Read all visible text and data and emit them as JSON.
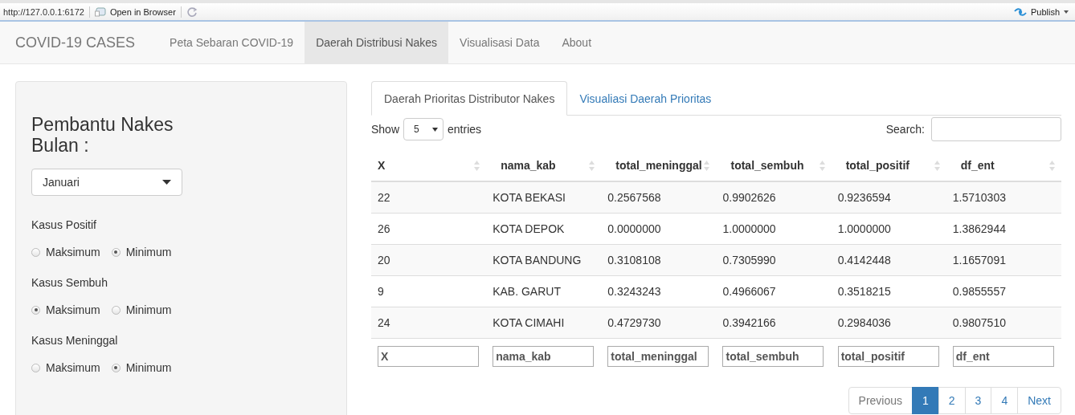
{
  "browser_bar": {
    "url": "http://127.0.0.1:6172",
    "open_in_browser": "Open in Browser",
    "publish": "Publish"
  },
  "navbar": {
    "brand": "COVID-19 CASES",
    "items": [
      {
        "label": "Peta Sebaran COVID-19",
        "selected": false
      },
      {
        "label": "Daerah Distribusi Nakes",
        "selected": true
      },
      {
        "label": "Visualisasi Data",
        "selected": false
      },
      {
        "label": "About",
        "selected": false
      }
    ]
  },
  "sidebar": {
    "title": "Pembantu Nakes Bulan :",
    "month_select": {
      "value": "Januari"
    },
    "groups": [
      {
        "label": "Kasus Positif",
        "options": [
          {
            "label": "Maksimum",
            "selected": false
          },
          {
            "label": "Minimum",
            "selected": true
          }
        ]
      },
      {
        "label": "Kasus Sembuh",
        "options": [
          {
            "label": "Maksimum",
            "selected": true
          },
          {
            "label": "Minimum",
            "selected": false
          }
        ]
      },
      {
        "label": "Kasus Meninggal",
        "options": [
          {
            "label": "Maksimum",
            "selected": false
          },
          {
            "label": "Minimum",
            "selected": true
          }
        ]
      }
    ]
  },
  "tabs": [
    {
      "label": "Daerah Prioritas Distributor Nakes",
      "selected": true
    },
    {
      "label": "Visualiasi Daerah Prioritas",
      "selected": false
    }
  ],
  "table_controls": {
    "show_label": "Show",
    "page_length": "5",
    "entries_label": "entries",
    "search_label": "Search:"
  },
  "table": {
    "columns": [
      "X",
      "nama_kab",
      "total_meninggal",
      "total_sembuh",
      "total_positif",
      "df_ent"
    ],
    "rows": [
      [
        "22",
        "KOTA BEKASI",
        "0.2567568",
        "0.9902626",
        "0.9236594",
        "1.5710303"
      ],
      [
        "26",
        "KOTA DEPOK",
        "0.0000000",
        "1.0000000",
        "1.0000000",
        "1.3862944"
      ],
      [
        "20",
        "KOTA BANDUNG",
        "0.3108108",
        "0.7305990",
        "0.4142448",
        "1.1657091"
      ],
      [
        "9",
        "KAB. GARUT",
        "0.3243243",
        "0.4966067",
        "0.3518215",
        "0.9855557"
      ],
      [
        "24",
        "KOTA CIMAHI",
        "0.4729730",
        "0.3942166",
        "0.2984036",
        "0.9807510"
      ]
    ],
    "filters": [
      "X",
      "nama_kab",
      "total_meninggal",
      "total_sembuh",
      "total_positif",
      "df_ent"
    ]
  },
  "pagination": {
    "previous": "Previous",
    "pages": [
      {
        "label": "1",
        "selected": true
      },
      {
        "label": "2",
        "selected": false
      },
      {
        "label": "3",
        "selected": false
      },
      {
        "label": "4",
        "selected": false
      }
    ],
    "next": "Next"
  }
}
